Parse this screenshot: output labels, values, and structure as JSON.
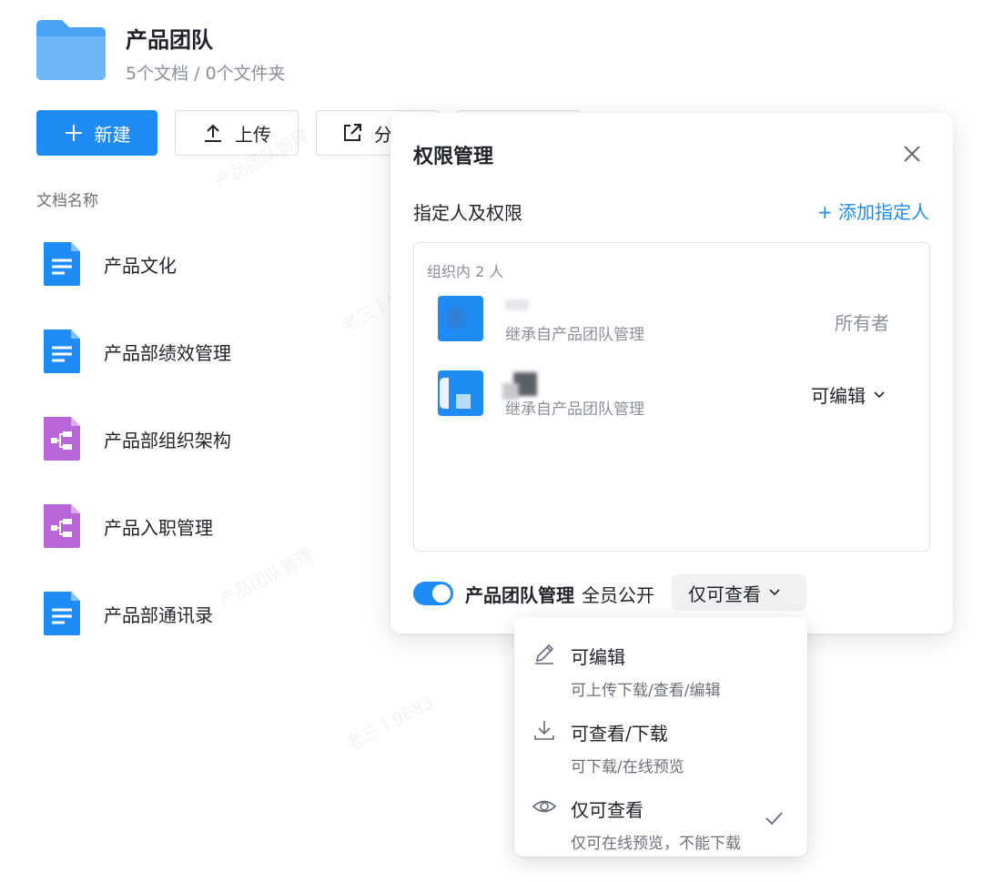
{
  "folder": {
    "title": "产品团队",
    "subtitle": "5个文档 / 0个文件夹",
    "icon": "folder-icon"
  },
  "toolbar": {
    "new_label": "新建",
    "upload_label": "上传",
    "share_label": "分"
  },
  "list": {
    "column_header": "文档名称",
    "files": [
      {
        "name": "产品文化",
        "type": "doc"
      },
      {
        "name": "产品部绩效管理",
        "type": "doc"
      },
      {
        "name": "产品部组织架构",
        "type": "mindmap"
      },
      {
        "name": "产品入职管理",
        "type": "mindmap"
      },
      {
        "name": "产品部通讯录",
        "type": "doc"
      }
    ]
  },
  "watermark": "产品团队管理",
  "watermark_alt": "老三丨9683",
  "permission_panel": {
    "title": "权限管理",
    "section_label": "指定人及权限",
    "add_link": "+ 添加指定人",
    "group_label": "组织内 2 人",
    "members": [
      {
        "inherit": "继承自产品团队管理",
        "role": "所有者"
      },
      {
        "inherit": "继承自产品团队管理",
        "role": "可编辑"
      }
    ],
    "public": {
      "enabled": true,
      "group_name": "产品团队管理",
      "text": "全员公开",
      "level": "仅可查看"
    }
  },
  "dropdown": {
    "options": [
      {
        "title": "可编辑",
        "desc": "可上传下载/查看/编辑",
        "icon": "pencil-icon",
        "selected": false
      },
      {
        "title": "可查看/下载",
        "desc": "可下载/在线预览",
        "icon": "download-icon",
        "selected": false
      },
      {
        "title": "仅可查看",
        "desc": "仅可在线预览，不能下载",
        "icon": "eye-icon",
        "selected": true
      }
    ]
  },
  "colors": {
    "accent": "#1f8bf5",
    "doc_icon": "#1f8bf5",
    "mindmap_icon": "#b865d8"
  }
}
